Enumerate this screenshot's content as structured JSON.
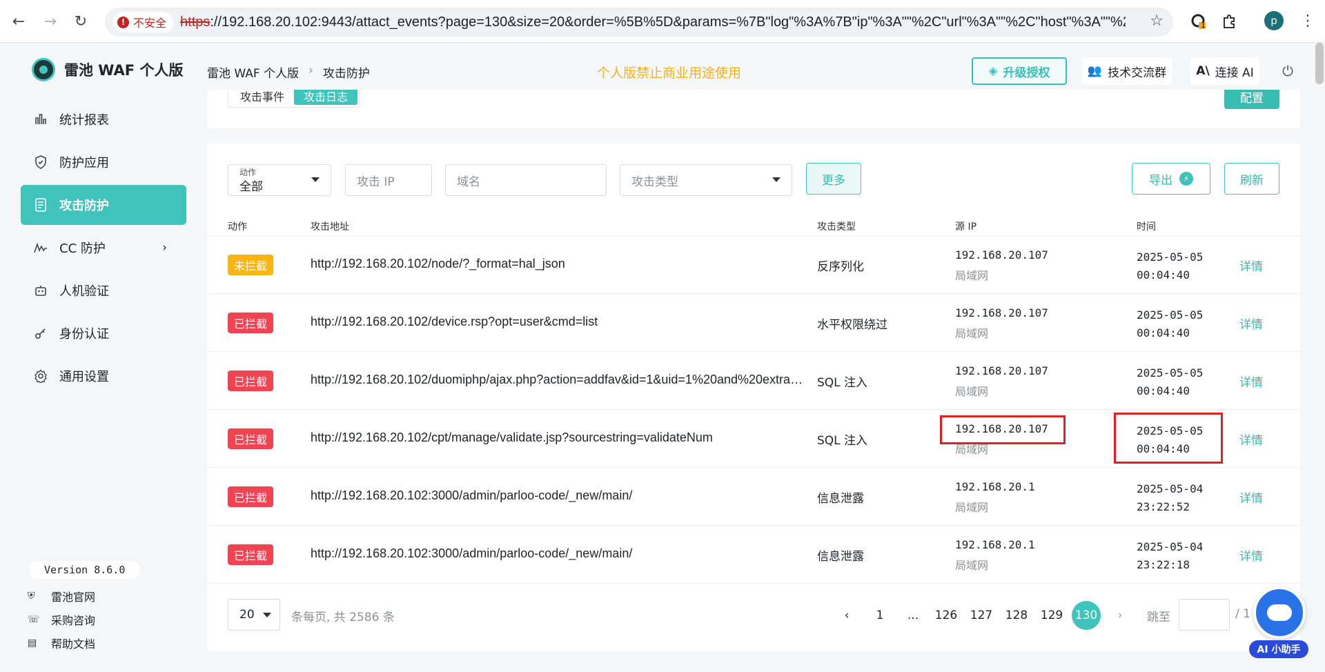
{
  "browser": {
    "security_label": "不安全",
    "url_scheme": "https",
    "url_rest": "://192.168.20.102:9443/attact_events?page=130&size=20&order=%5B%5D&params=%7B\"log\"%3A%7B\"ip\"%3A\"\"%2C\"url\"%3A\"\"%2C\"host\"%3A\"\"%2C\"port\"...",
    "profile_initial": "p",
    "ext_badge": "1"
  },
  "header": {
    "brand": "雷池 WAF 个人版",
    "breadcrumb": [
      "雷池 WAF 个人版",
      "攻击防护"
    ],
    "notice": "个人版禁止商业用途使用",
    "upgrade_label": "升级授权",
    "group_label": "技术交流群",
    "ai_label": "连接 AI"
  },
  "sidebar": {
    "items": [
      {
        "label": "统计报表",
        "icon": "bar-chart-icon"
      },
      {
        "label": "防护应用",
        "icon": "shield-icon"
      },
      {
        "label": "攻击防护",
        "icon": "document-icon",
        "active": true
      },
      {
        "label": "CC 防护",
        "icon": "pulse-icon",
        "expandable": true
      },
      {
        "label": "人机验证",
        "icon": "robot-icon"
      },
      {
        "label": "身份认证",
        "icon": "key-icon"
      },
      {
        "label": "通用设置",
        "icon": "gear-icon"
      }
    ],
    "version": "Version 8.6.0",
    "footer_links": [
      {
        "label": "雷池官网",
        "icon": "shield-small-icon"
      },
      {
        "label": "采购咨询",
        "icon": "headset-icon"
      },
      {
        "label": "帮助文档",
        "icon": "doc-small-icon"
      }
    ]
  },
  "topcard": {
    "tabs": [
      "攻击事件",
      "攻击日志"
    ],
    "active_tab": 1,
    "config_label": "配置"
  },
  "filters": {
    "action_label": "动作",
    "action_value": "全部",
    "ip_placeholder": "攻击 IP",
    "domain_placeholder": "域名",
    "type_placeholder": "攻击类型",
    "more_label": "更多",
    "export_label": "导出",
    "refresh_label": "刷新"
  },
  "table": {
    "columns": [
      "动作",
      "攻击地址",
      "攻击类型",
      "源 IP",
      "时间"
    ],
    "detail_label": "详情",
    "rows": [
      {
        "action": "未拦截",
        "action_status": "not-blocked",
        "url": "http://192.168.20.102/node/?_format=hal_json",
        "type": "反序列化",
        "ip": "192.168.20.107",
        "net": "局域网",
        "date": "2025-05-05",
        "time": "00:04:40"
      },
      {
        "action": "已拦截",
        "action_status": "blocked",
        "url": "http://192.168.20.102/device.rsp?opt=user&cmd=list",
        "type": "水平权限绕过",
        "ip": "192.168.20.107",
        "net": "局域网",
        "date": "2025-05-05",
        "time": "00:04:40"
      },
      {
        "action": "已拦截",
        "action_status": "blocked",
        "url": "http://192.168.20.102/duomiphp/ajax.php?action=addfav&id=1&uid=1%20and%20extract...",
        "type": "SQL 注入",
        "ip": "192.168.20.107",
        "net": "局域网",
        "date": "2025-05-05",
        "time": "00:04:40"
      },
      {
        "action": "已拦截",
        "action_status": "blocked",
        "url": "http://192.168.20.102/cpt/manage/validate.jsp?sourcestring=validateNum",
        "type": "SQL 注入",
        "ip": "192.168.20.107",
        "net": "局域网",
        "date": "2025-05-05",
        "time": "00:04:40",
        "highlighted": true
      },
      {
        "action": "已拦截",
        "action_status": "blocked",
        "url": "http://192.168.20.102:3000/admin/parloo-code/_new/main/",
        "type": "信息泄露",
        "ip": "192.168.20.1",
        "net": "局域网",
        "date": "2025-05-04",
        "time": "23:22:52"
      },
      {
        "action": "已拦截",
        "action_status": "blocked",
        "url": "http://192.168.20.102:3000/admin/parloo-code/_new/main/",
        "type": "信息泄露",
        "ip": "192.168.20.1",
        "net": "局域网",
        "date": "2025-05-04",
        "time": "23:22:18"
      }
    ]
  },
  "pagination": {
    "page_size": "20",
    "info": "条每页, 共 2586 条",
    "pages": [
      "1",
      "...",
      "126",
      "127",
      "128",
      "129",
      "130"
    ],
    "current": "130",
    "jump_label": "跳至",
    "total_pages_suffix": "/ 1"
  },
  "assistant": {
    "label": "AI 小助手"
  },
  "colors": {
    "accent": "#40c3bb",
    "blocked": "#f04452",
    "not_blocked": "#f8b514",
    "notice": "#f5b21c",
    "highlight": "#e02020"
  }
}
